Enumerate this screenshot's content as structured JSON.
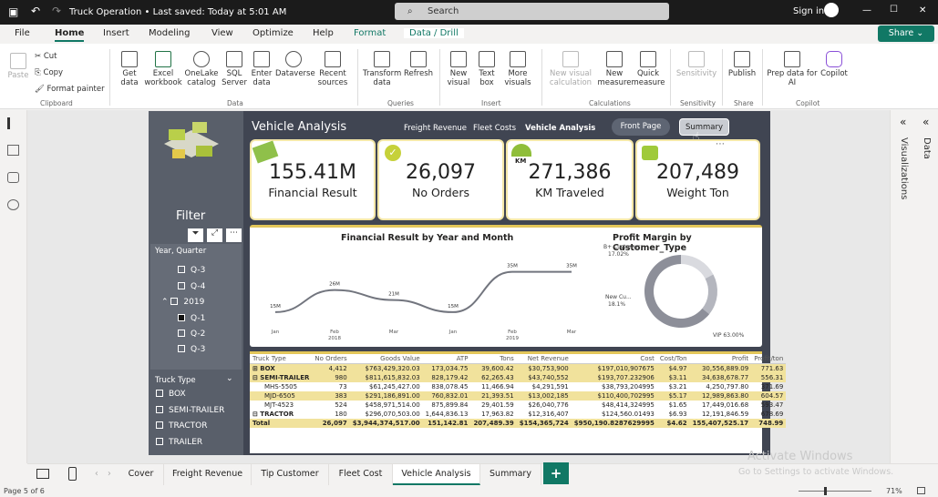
{
  "titlebar": {
    "title": "Truck Operation • Last saved: Today at 5:01 AM",
    "search_placeholder": "Search",
    "signin": "Sign in",
    "minimize": "—",
    "maximize": "☐",
    "close": "✕"
  },
  "menubar": {
    "items": [
      "File",
      "Home",
      "Insert",
      "Modeling",
      "View",
      "Optimize",
      "Help",
      "Format",
      "Data / Drill"
    ],
    "share": "Share"
  },
  "ribbon": {
    "clipboard": {
      "paste": "Paste",
      "cut": "Cut",
      "copy": "Copy",
      "format_painter": "Format painter",
      "group": "Clipboard"
    },
    "data": {
      "get_data": "Get data",
      "excel": "Excel workbook",
      "onelake": "OneLake catalog",
      "sql": "SQL Server",
      "enter": "Enter data",
      "dataverse": "Dataverse",
      "recent": "Recent sources",
      "group": "Data"
    },
    "queries": {
      "transform": "Transform data",
      "refresh": "Refresh",
      "group": "Queries"
    },
    "insert": {
      "new_visual": "New visual",
      "text_box": "Text box",
      "more_visuals": "More visuals",
      "group": "Insert"
    },
    "calculations": {
      "new_visual_calc": "New visual calculation",
      "new_measure": "New measure",
      "quick_measure": "Quick measure",
      "group": "Calculations"
    },
    "sensitivity": {
      "label": "Sensitivity",
      "group": "Sensitivity"
    },
    "share": {
      "publish": "Publish",
      "group": "Share"
    },
    "copilot": {
      "prep": "Prep data for AI",
      "copilot": "Copilot",
      "group": "Copilot"
    }
  },
  "report": {
    "title": "Vehicle Analysis",
    "nav": [
      "Freight Revenue",
      "Fleet Costs",
      "Vehicle Analysis"
    ],
    "front_page": "Front Page",
    "summary": "Summary",
    "filter_label": "Filter",
    "slicer1": {
      "title": "Year, Quarter",
      "items": [
        "Q-3",
        "Q-4",
        "2019",
        "Q-1",
        "Q-2",
        "Q-3"
      ]
    },
    "slicer2": {
      "title": "Truck Type",
      "items": [
        "BOX",
        "SEMI-TRAILER",
        "TRACTOR",
        "TRAILER"
      ]
    },
    "cards": [
      {
        "value": "155.41M",
        "label": "Financial Result"
      },
      {
        "value": "26,097",
        "label": "No Orders"
      },
      {
        "value": "271,386",
        "label": "KM Traveled"
      },
      {
        "value": "207,489",
        "label": "Weight Ton"
      }
    ],
    "line_chart": {
      "title": "Financial Result by Year and Month",
      "xlabels": [
        "Jan",
        "Feb",
        "Mar",
        "Jan",
        "Feb",
        "Mar"
      ],
      "years": [
        "2018",
        "2019"
      ],
      "data_labels": [
        "15M",
        "26M",
        "21M",
        "15M",
        "35M",
        "35M"
      ],
      "values": [
        15,
        26,
        21,
        15,
        35,
        35
      ]
    },
    "donut": {
      "title": "Profit Margin by Customer_Type",
      "labels": [
        "B+ Customer",
        "New Cu...",
        "VIP 63.00%"
      ],
      "pcts": [
        "17.02%",
        "18.1%"
      ],
      "values": [
        17.02,
        18.1,
        63.0
      ]
    },
    "table": {
      "headers": [
        "Truck Type",
        "No Orders",
        "Goods Value",
        "ATP",
        "Tons",
        "Net Revenue",
        "Cost",
        "Cost/Ton",
        "Profit",
        "Profit/ton"
      ],
      "rows": [
        [
          "⊞ BOX",
          "4,412",
          "$763,429,320.03",
          "173,034.75",
          "39,600.42",
          "$30,753,900",
          "$197,010,907675",
          "$4.97",
          "30,556,889.09",
          "771.63"
        ],
        [
          "⊟ SEMI-TRAILER",
          "980",
          "$811,615,832.03",
          "828,179.42",
          "62,265.43",
          "$43,740,552",
          "$193,707.232906",
          "$3.11",
          "34,638,678.77",
          "556.31"
        ],
        [
          "MHS-5505",
          "73",
          "$61,245,427.00",
          "838,078.45",
          "11,466.94",
          "$4,291,591",
          "$38,793,204995",
          "$3.21",
          "4,250,797.80",
          "371.69"
        ],
        [
          "MJD-6505",
          "383",
          "$291,186,891.00",
          "760,832.01",
          "21,393.51",
          "$13,002,185",
          "$110,400,702995",
          "$5.17",
          "12,989,863.80",
          "604.57"
        ],
        [
          "MJT-4523",
          "524",
          "$458,971,514.00",
          "875,899.84",
          "29,401.59",
          "$26,040,776",
          "$48,414,324995",
          "$1.65",
          "17,449,016.68",
          "593.47"
        ],
        [
          "⊟ TRACTOR",
          "180",
          "$296,070,503.00",
          "1,644,836.13",
          "17,963.82",
          "$12,316,407",
          "$124,560.01493",
          "$6.93",
          "12,191,846.59",
          "678.69"
        ],
        [
          "Total",
          "26,097",
          "$3,944,374,517.00",
          "151,142.81",
          "207,489.39",
          "$154,365,724",
          "$950,190.8287629995",
          "$4.62",
          "155,407,525.17",
          "748.99"
        ]
      ]
    }
  },
  "tabs": [
    "Cover",
    "Freight Revenue",
    "Tip Customer",
    "Fleet Cost",
    "Vehicle Analysis",
    "Summary"
  ],
  "add_tab": "+",
  "rightpane": {
    "visualizations": "Visualizations",
    "data": "Data"
  },
  "status": {
    "page": "Page 5 of 6",
    "zoom": "71%",
    "watermark_title": "Activate Windows",
    "watermark_sub": "Go to Settings to activate Windows."
  }
}
